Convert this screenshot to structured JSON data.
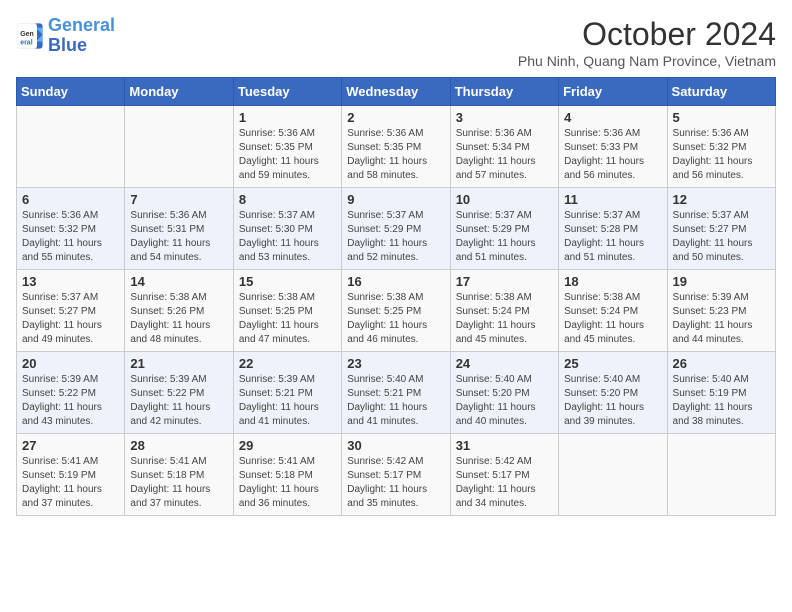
{
  "logo": {
    "line1": "General",
    "line2": "Blue"
  },
  "title": "October 2024",
  "subtitle": "Phu Ninh, Quang Nam Province, Vietnam",
  "days_of_week": [
    "Sunday",
    "Monday",
    "Tuesday",
    "Wednesday",
    "Thursday",
    "Friday",
    "Saturday"
  ],
  "weeks": [
    [
      {
        "day": "",
        "info": ""
      },
      {
        "day": "",
        "info": ""
      },
      {
        "day": "1",
        "info": "Sunrise: 5:36 AM\nSunset: 5:35 PM\nDaylight: 11 hours\nand 59 minutes."
      },
      {
        "day": "2",
        "info": "Sunrise: 5:36 AM\nSunset: 5:35 PM\nDaylight: 11 hours\nand 58 minutes."
      },
      {
        "day": "3",
        "info": "Sunrise: 5:36 AM\nSunset: 5:34 PM\nDaylight: 11 hours\nand 57 minutes."
      },
      {
        "day": "4",
        "info": "Sunrise: 5:36 AM\nSunset: 5:33 PM\nDaylight: 11 hours\nand 56 minutes."
      },
      {
        "day": "5",
        "info": "Sunrise: 5:36 AM\nSunset: 5:32 PM\nDaylight: 11 hours\nand 56 minutes."
      }
    ],
    [
      {
        "day": "6",
        "info": "Sunrise: 5:36 AM\nSunset: 5:32 PM\nDaylight: 11 hours\nand 55 minutes."
      },
      {
        "day": "7",
        "info": "Sunrise: 5:36 AM\nSunset: 5:31 PM\nDaylight: 11 hours\nand 54 minutes."
      },
      {
        "day": "8",
        "info": "Sunrise: 5:37 AM\nSunset: 5:30 PM\nDaylight: 11 hours\nand 53 minutes."
      },
      {
        "day": "9",
        "info": "Sunrise: 5:37 AM\nSunset: 5:29 PM\nDaylight: 11 hours\nand 52 minutes."
      },
      {
        "day": "10",
        "info": "Sunrise: 5:37 AM\nSunset: 5:29 PM\nDaylight: 11 hours\nand 51 minutes."
      },
      {
        "day": "11",
        "info": "Sunrise: 5:37 AM\nSunset: 5:28 PM\nDaylight: 11 hours\nand 51 minutes."
      },
      {
        "day": "12",
        "info": "Sunrise: 5:37 AM\nSunset: 5:27 PM\nDaylight: 11 hours\nand 50 minutes."
      }
    ],
    [
      {
        "day": "13",
        "info": "Sunrise: 5:37 AM\nSunset: 5:27 PM\nDaylight: 11 hours\nand 49 minutes."
      },
      {
        "day": "14",
        "info": "Sunrise: 5:38 AM\nSunset: 5:26 PM\nDaylight: 11 hours\nand 48 minutes."
      },
      {
        "day": "15",
        "info": "Sunrise: 5:38 AM\nSunset: 5:25 PM\nDaylight: 11 hours\nand 47 minutes."
      },
      {
        "day": "16",
        "info": "Sunrise: 5:38 AM\nSunset: 5:25 PM\nDaylight: 11 hours\nand 46 minutes."
      },
      {
        "day": "17",
        "info": "Sunrise: 5:38 AM\nSunset: 5:24 PM\nDaylight: 11 hours\nand 45 minutes."
      },
      {
        "day": "18",
        "info": "Sunrise: 5:38 AM\nSunset: 5:24 PM\nDaylight: 11 hours\nand 45 minutes."
      },
      {
        "day": "19",
        "info": "Sunrise: 5:39 AM\nSunset: 5:23 PM\nDaylight: 11 hours\nand 44 minutes."
      }
    ],
    [
      {
        "day": "20",
        "info": "Sunrise: 5:39 AM\nSunset: 5:22 PM\nDaylight: 11 hours\nand 43 minutes."
      },
      {
        "day": "21",
        "info": "Sunrise: 5:39 AM\nSunset: 5:22 PM\nDaylight: 11 hours\nand 42 minutes."
      },
      {
        "day": "22",
        "info": "Sunrise: 5:39 AM\nSunset: 5:21 PM\nDaylight: 11 hours\nand 41 minutes."
      },
      {
        "day": "23",
        "info": "Sunrise: 5:40 AM\nSunset: 5:21 PM\nDaylight: 11 hours\nand 41 minutes."
      },
      {
        "day": "24",
        "info": "Sunrise: 5:40 AM\nSunset: 5:20 PM\nDaylight: 11 hours\nand 40 minutes."
      },
      {
        "day": "25",
        "info": "Sunrise: 5:40 AM\nSunset: 5:20 PM\nDaylight: 11 hours\nand 39 minutes."
      },
      {
        "day": "26",
        "info": "Sunrise: 5:40 AM\nSunset: 5:19 PM\nDaylight: 11 hours\nand 38 minutes."
      }
    ],
    [
      {
        "day": "27",
        "info": "Sunrise: 5:41 AM\nSunset: 5:19 PM\nDaylight: 11 hours\nand 37 minutes."
      },
      {
        "day": "28",
        "info": "Sunrise: 5:41 AM\nSunset: 5:18 PM\nDaylight: 11 hours\nand 37 minutes."
      },
      {
        "day": "29",
        "info": "Sunrise: 5:41 AM\nSunset: 5:18 PM\nDaylight: 11 hours\nand 36 minutes."
      },
      {
        "day": "30",
        "info": "Sunrise: 5:42 AM\nSunset: 5:17 PM\nDaylight: 11 hours\nand 35 minutes."
      },
      {
        "day": "31",
        "info": "Sunrise: 5:42 AM\nSunset: 5:17 PM\nDaylight: 11 hours\nand 34 minutes."
      },
      {
        "day": "",
        "info": ""
      },
      {
        "day": "",
        "info": ""
      }
    ]
  ]
}
